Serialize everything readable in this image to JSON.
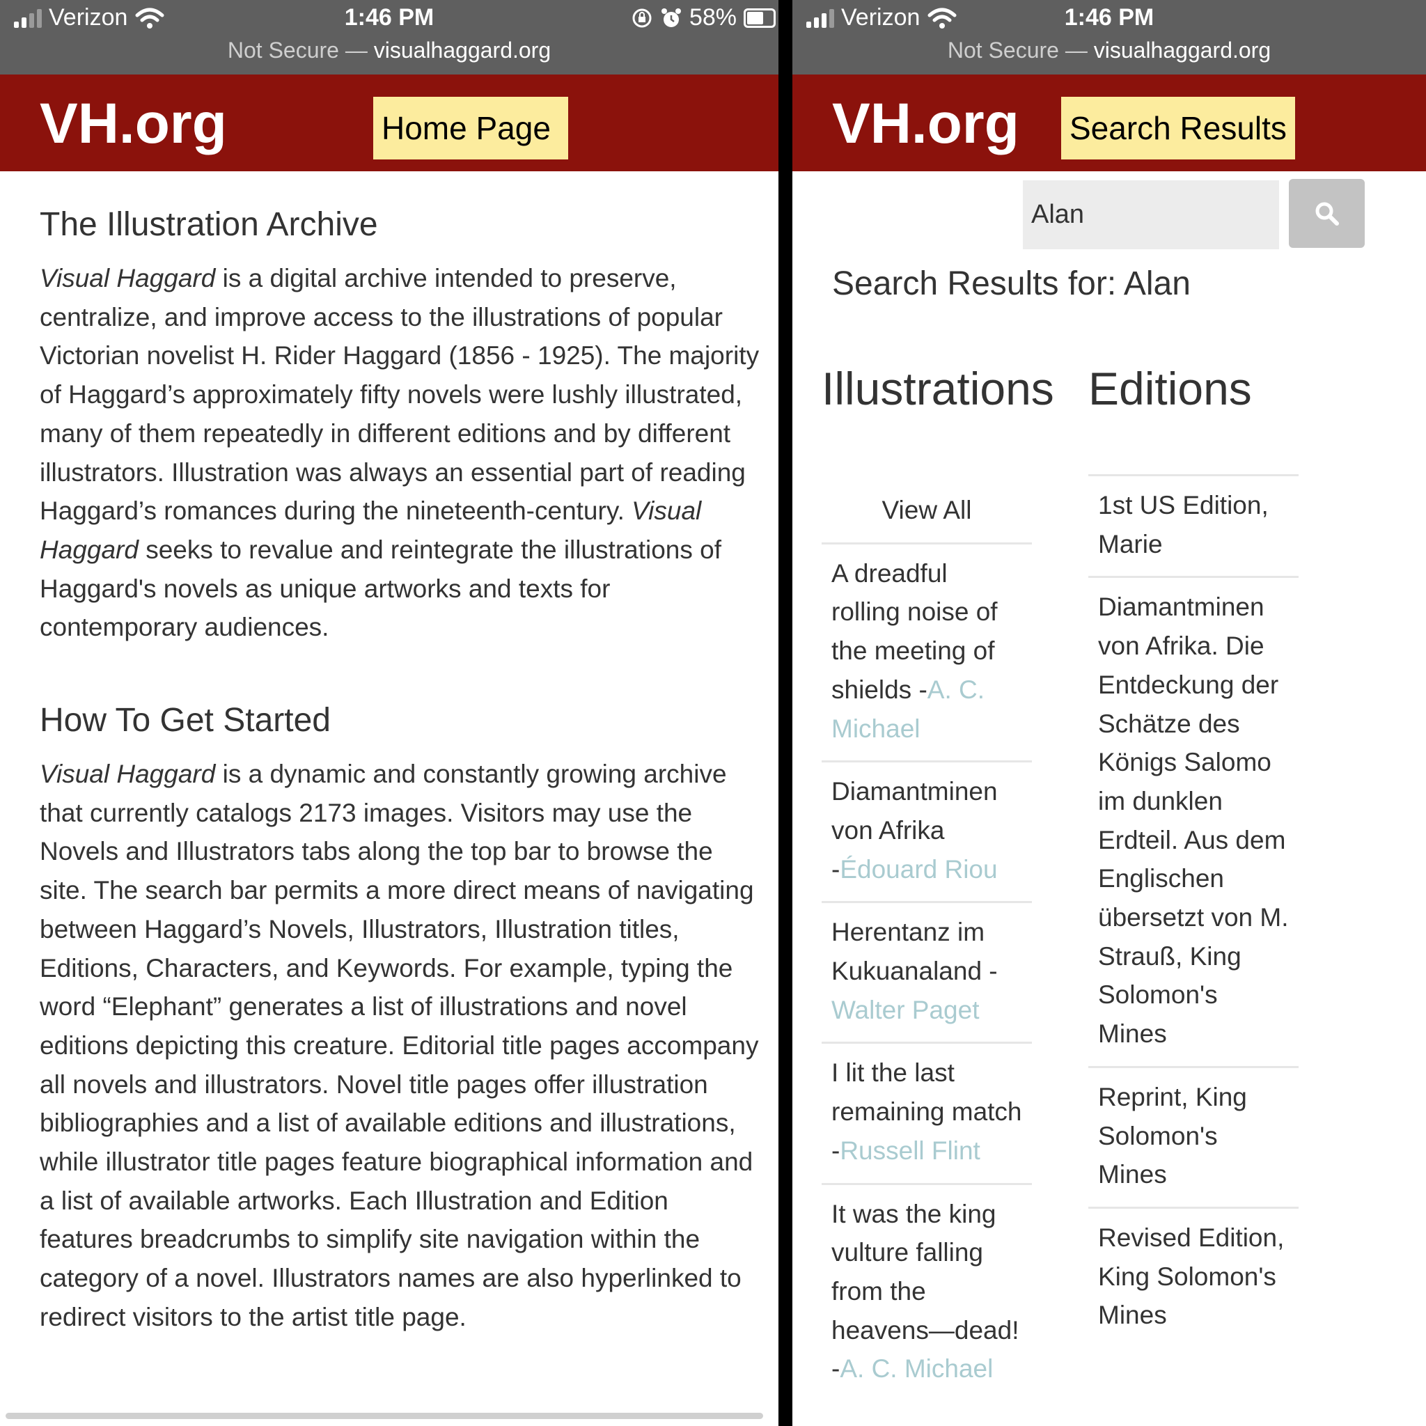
{
  "status_bar": {
    "carrier": "Verizon",
    "time": "1:46 PM",
    "battery": "58%",
    "url_prefix": "Not Secure — ",
    "url_domain": "visualhaggard.org"
  },
  "colors": {
    "header": "#8b120c",
    "label_bg": "#fcec9e",
    "link": "#a9cbd0"
  },
  "icons": [
    "signal-icon",
    "wifi-icon",
    "rotation-lock-icon",
    "alarm-icon",
    "battery-icon",
    "search-icon"
  ],
  "left": {
    "logo": "VH.org",
    "page_label": "Home Page",
    "section1": {
      "title": "The Illustration Archive",
      "lead_italic": "Visual Haggard",
      "text_a": " is a digital archive intended to preserve, centralize, and improve access to the illustrations of popular Victorian novelist H. Rider Haggard (1856 - 1925). The majority of Haggard’s approximately fifty novels were lushly illustrated, many of them repeatedly in different editions and by different illustrators. Illustration was always an essential part of reading Haggard’s romances during the nineteenth-century. ",
      "mid_italic": "Visual Haggard",
      "text_b": " seeks to revalue and reintegrate the illustrations of Haggard's novels as unique artworks and texts for contemporary audiences."
    },
    "section2": {
      "title": "How To Get Started",
      "lead_italic": "Visual Haggard",
      "text": " is a dynamic and constantly growing archive that currently catalogs 2173 images. Visitors may use the Novels and Illustrators tabs along the top bar to browse the site. The search bar permits a more direct means of navigating between Haggard’s Novels, Illustrators, Illustration titles, Editions, Characters, and Keywords. For example, typing the word “Elephant” generates a list of illustrations and novel editions depicting this creature. Editorial title pages accompany all novels and illustrators. Novel title pages offer illustration bibliographies and a list of available editions and illustrations, while illustrator title pages feature biographical information and a list of available artworks. Each Illustration and Edition features breadcrumbs to simplify site navigation within the category of a novel. Illustrators names are also hyperlinked to redirect visitors to the artist title page."
    }
  },
  "right": {
    "logo": "VH.org",
    "page_label": "Search Results",
    "search_value": "Alan",
    "results_heading": "Search Results for: Alan",
    "illustrations_heading": "Illustrations",
    "editions_heading": "Editions",
    "view_all": "View All",
    "illustrations": [
      {
        "title": "A dreadful rolling noise of the meeting of shields -",
        "artist": "A. C. Michael"
      },
      {
        "title": "Diamantminen von Afrika -",
        "artist": "Édouard Riou"
      },
      {
        "title": "Herentanz im Kukuanaland -",
        "artist": "Walter Paget"
      },
      {
        "title": "I lit the last remaining match -",
        "artist": "Russell Flint"
      },
      {
        "title": "It was the king vulture falling from the heavens—dead! -",
        "artist": "A. C. Michael"
      }
    ],
    "editions": [
      "1st US Edition, Marie",
      "Diamantminen von Afrika. Die Entdeckung der Schätze des Königs Salomo im dunklen Erdteil. Aus dem Englischen übersetzt von M. Strauß, King Solomon's Mines",
      "Reprint, King Solomon's Mines",
      "Revised Edition, King Solomon's Mines"
    ]
  }
}
